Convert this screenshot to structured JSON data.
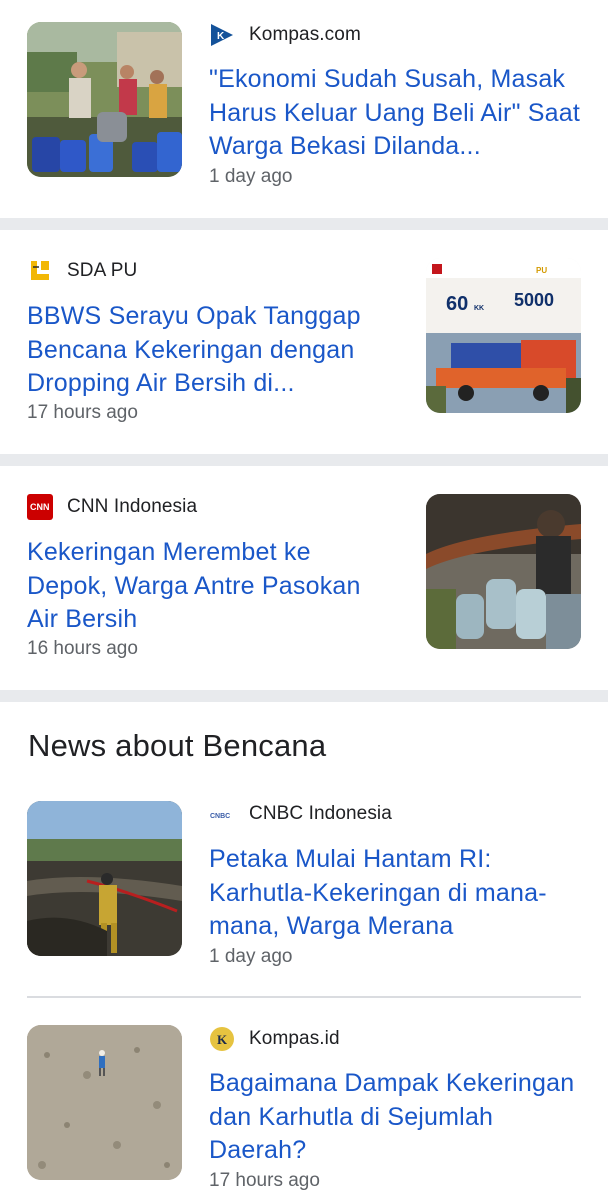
{
  "articles": [
    {
      "source": "Kompas.com",
      "headline": "\"Ekonomi Sudah Susah, Masak Harus Keluar Uang Beli Air\" Saat Warga Bekasi Dilanda...",
      "time": "1 day ago",
      "logo_icon": "kompas-com-logo-icon",
      "thumb": "people-with-water-jerrycans"
    },
    {
      "source": "SDA PU",
      "headline": "BBWS Serayu Opak Tanggap Bencana Kekeringan dengan Dropping Air Bersih di...",
      "time": "17 hours ago",
      "logo_icon": "pu-logo-icon",
      "thumb": "water-truck-infographic",
      "thumb_text": {
        "brand": "PU",
        "stat1": "60",
        "stat1_unit": "KK",
        "stat2": "5000"
      }
    },
    {
      "source": "CNN Indonesia",
      "headline": "Kekeringan Merembet ke Depok, Warga Antre Pasokan Air Bersih",
      "time": "16 hours ago",
      "logo_icon": "cnn-logo-icon",
      "thumb": "filling-water-gallons"
    }
  ],
  "section": {
    "title": "News about Bencana",
    "articles": [
      {
        "source": "CNBC Indonesia",
        "headline": "Petaka Mulai Hantam RI: Karhutla-Kekeringan di mana-mana, Warga Merana",
        "time": "1 day ago",
        "logo_icon": "cnbc-logo-icon",
        "thumb": "firefighter-spraying-water"
      },
      {
        "source": "Kompas.id",
        "headline": "Bagaimana Dampak Kekeringan dan Karhutla di Sejumlah Daerah?",
        "time": "17 hours ago",
        "logo_icon": "kompas-id-logo-icon",
        "thumb": "dry-cracked-riverbed"
      }
    ]
  },
  "colors": {
    "headline": "#1a57c8",
    "divider": "#e8eaed",
    "meta": "#5f6368"
  }
}
